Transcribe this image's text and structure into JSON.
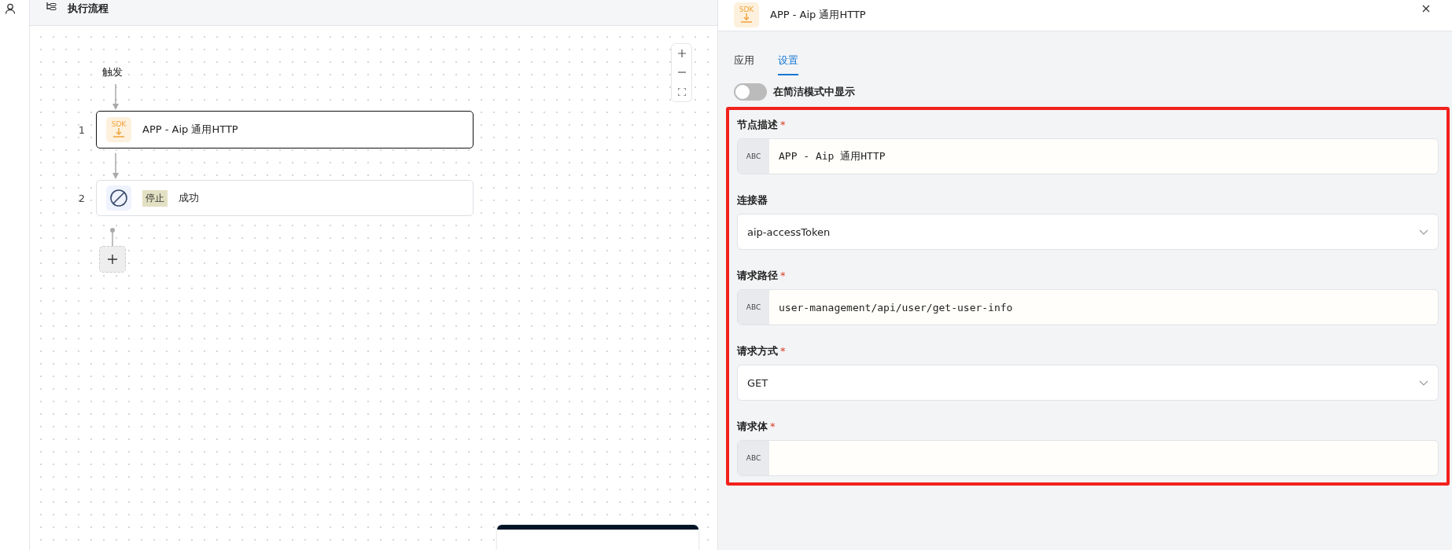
{
  "flow_panel": {
    "title": "执行流程",
    "trigger": "触发",
    "steps": [
      {
        "number": "1",
        "kind": "sdk",
        "icon_text": "SDK",
        "title": "APP - Aip 通用HTTP",
        "selected": true
      },
      {
        "number": "2",
        "kind": "stop",
        "tag": "停止",
        "title": "成功",
        "selected": false
      }
    ]
  },
  "detail_panel": {
    "title": "APP - Aip 通用HTTP",
    "icon_text": "SDK",
    "tabs": [
      {
        "label": "应用",
        "selected": false
      },
      {
        "label": "设置",
        "selected": true
      }
    ],
    "compact_toggle": {
      "label": "在简洁模式中显示",
      "on": false
    },
    "fields_highlighted": true,
    "fields": [
      {
        "kind": "text",
        "label": "节点描述",
        "required_mark": "*",
        "prefix": "ABC",
        "value": "APP - Aip 通用HTTP"
      },
      {
        "kind": "select",
        "label": "连接器",
        "value": "aip-accessToken"
      },
      {
        "kind": "text",
        "label": "请求路径",
        "required_mark": "*",
        "prefix": "ABC",
        "value": "user-management/api/user/get-user-info"
      },
      {
        "kind": "select",
        "label": "请求方式",
        "required_mark": "*",
        "value": "GET"
      },
      {
        "kind": "text",
        "label": "请求体",
        "required_mark": "*",
        "prefix": "ABC"
      }
    ]
  }
}
